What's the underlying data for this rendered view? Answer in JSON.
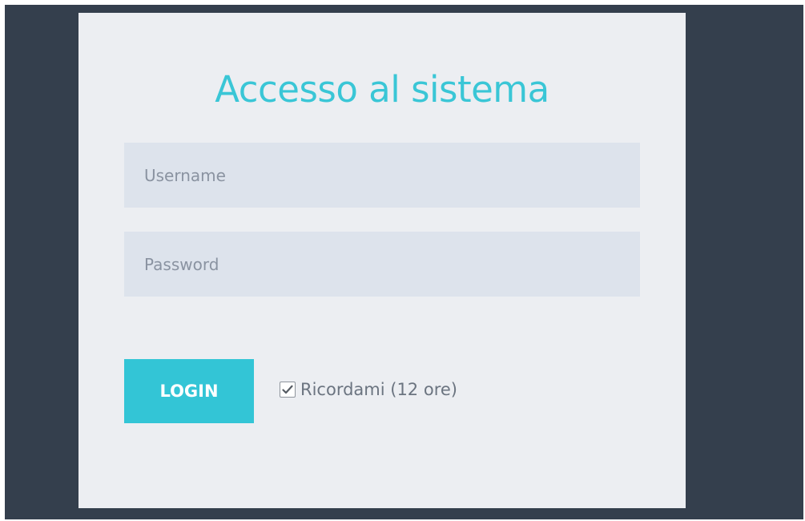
{
  "colors": {
    "accent": "#33c5d6",
    "title": "#3ac6d6",
    "input_background": "#dde3ec"
  },
  "login": {
    "title": "Accesso al sistema",
    "username": {
      "value": "",
      "placeholder": "Username"
    },
    "password": {
      "value": "",
      "placeholder": "Password"
    },
    "submit_label": "LOGIN",
    "remember": {
      "checked": true,
      "label": "Ricordami (12 ore)",
      "icon": "checkmark-icon"
    }
  }
}
